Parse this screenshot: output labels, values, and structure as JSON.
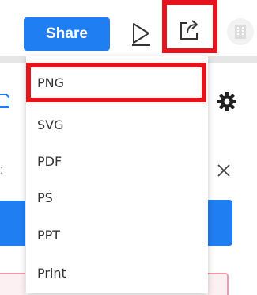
{
  "toolbar": {
    "share_label": "Share",
    "play_icon": "play-icon",
    "export_icon": "export-icon",
    "building_icon": "building-icon"
  },
  "export_menu": {
    "items": [
      {
        "label": "PNG",
        "highlighted": true
      },
      {
        "label": "SVG",
        "highlighted": false
      },
      {
        "label": "PDF",
        "highlighted": false
      },
      {
        "label": "PS",
        "highlighted": false
      },
      {
        "label": "PPT",
        "highlighted": false
      },
      {
        "label": "Print",
        "highlighted": false
      }
    ]
  },
  "backdrop": {
    "left_fragment_text": ":",
    "gear_icon": "gear-icon",
    "close_icon": "close-icon"
  },
  "colors": {
    "accent_blue": "#1f7ef2",
    "highlight_red": "#e8141c",
    "text": "#333333"
  }
}
